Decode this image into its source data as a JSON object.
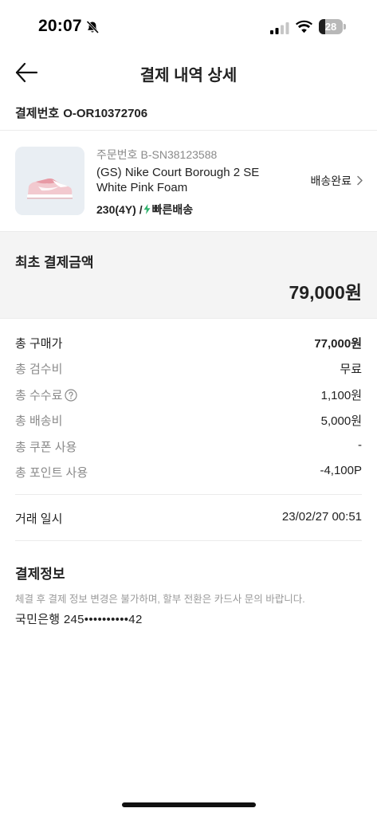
{
  "status_bar": {
    "time": "20:07",
    "battery": "28",
    "battery_level": 0.28
  },
  "header": {
    "title": "결제 내역 상세"
  },
  "payment_number": {
    "label": "결제번호",
    "value": "O-OR10372706"
  },
  "product": {
    "order_no_label": "주문번호",
    "order_no": "B-SN38123588",
    "name_line1": "(GS) Nike Court Borough 2 SE",
    "name_line2": "White Pink Foam",
    "size": "230(4Y)",
    "separator": "/",
    "shipping_type": "빠른배송",
    "status": "배송완료"
  },
  "initial_total": {
    "label": "최초 결제금액",
    "amount": "79,000원"
  },
  "breakdown": [
    {
      "label": "총 구매가",
      "value": "77,000원"
    },
    {
      "label": "총 검수비",
      "value": "무료"
    },
    {
      "label": "총 수수료",
      "value": "1,100원"
    },
    {
      "label": "총 배송비",
      "value": "5,000원"
    },
    {
      "label": "총 쿠폰 사용",
      "value": "-"
    },
    {
      "label": "총 포인트 사용",
      "value": "-4,100P"
    }
  ],
  "transaction": {
    "label": "거래 일시",
    "value": "23/02/27 00:51"
  },
  "payment_info": {
    "title": "결제정보",
    "note": "체결 후 결제 정보 변경은 불가하며, 할부 전환은 카드사 문의 바랍니다.",
    "card": "국민은행 245••••••••••42"
  },
  "colors": {
    "text": "#222222",
    "muted": "#8a8a8a",
    "section_bg": "#f4f4f4",
    "fast_shipping": "#31b46e"
  }
}
